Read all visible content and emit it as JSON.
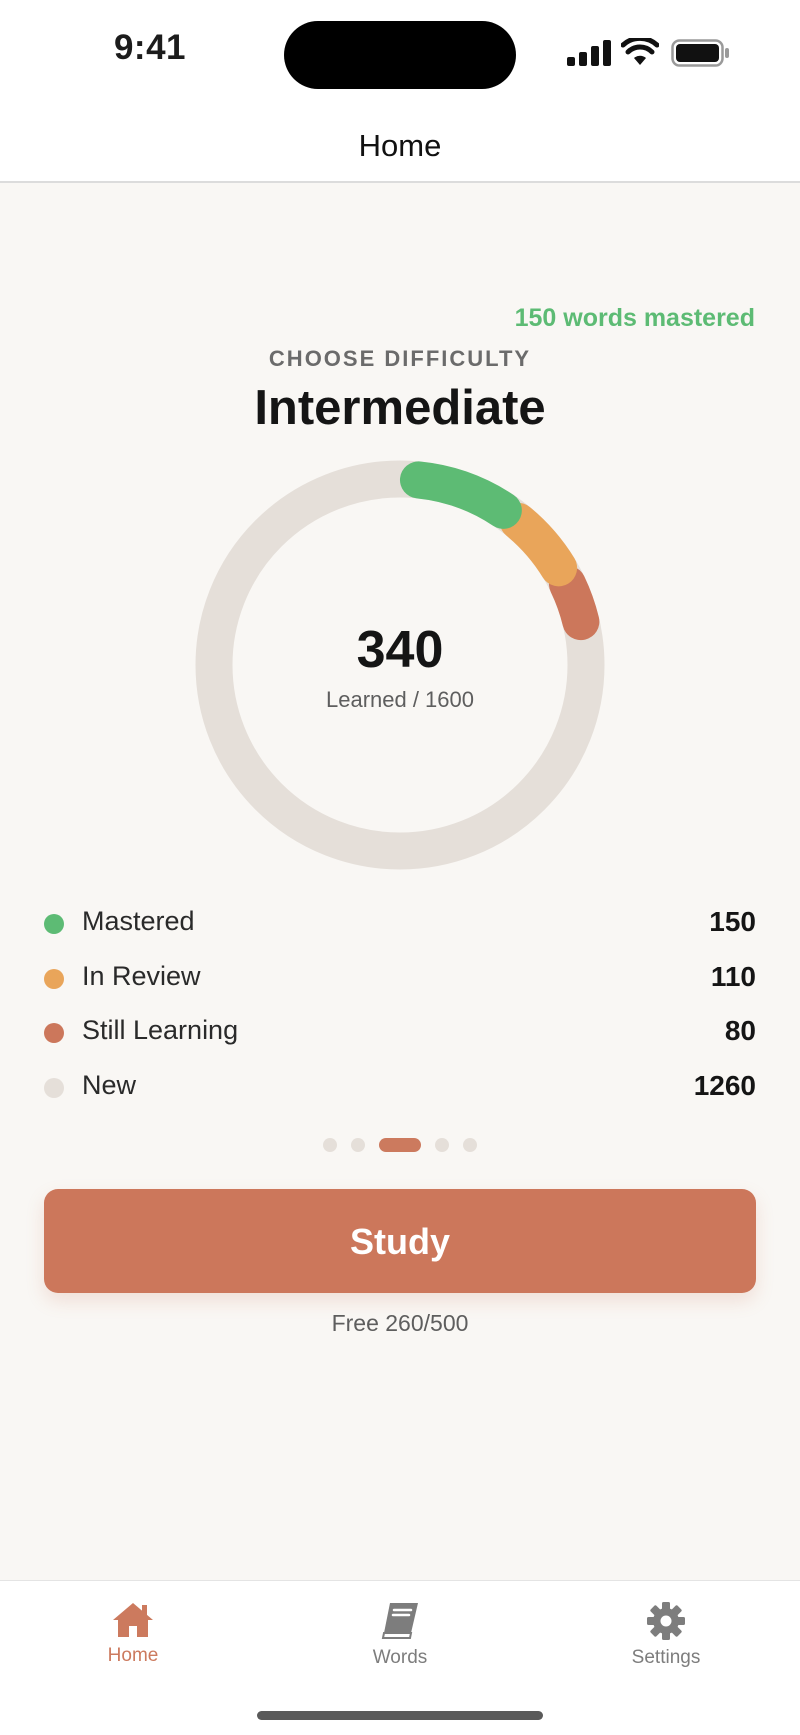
{
  "status_bar": {
    "time": "9:41"
  },
  "nav": {
    "title": "Home"
  },
  "summary": {
    "mastered_note": "150 words mastered",
    "choose_label": "CHOOSE DIFFICULTY",
    "difficulty": "Intermediate"
  },
  "ring": {
    "learned": "340",
    "subtitle": "Learned / 1600",
    "total": 1600
  },
  "colors": {
    "mastered": "#5dbb74",
    "in_review": "#e9a55a",
    "still_learning": "#cc775b",
    "new": "#e5dfd9",
    "accent": "#cc775b"
  },
  "legend": [
    {
      "label": "Mastered",
      "value": "150"
    },
    {
      "label": "In Review",
      "value": "110"
    },
    {
      "label": "Still Learning",
      "value": "80"
    },
    {
      "label": "New",
      "value": "1260"
    }
  ],
  "pager": {
    "count": 5,
    "active_index": 2
  },
  "study": {
    "label": "Study",
    "quota": "Free 260/500"
  },
  "tabs": [
    {
      "label": "Home",
      "icon": "home-icon",
      "active": true
    },
    {
      "label": "Words",
      "icon": "book-icon",
      "active": false
    },
    {
      "label": "Settings",
      "icon": "gear-icon",
      "active": false
    }
  ]
}
